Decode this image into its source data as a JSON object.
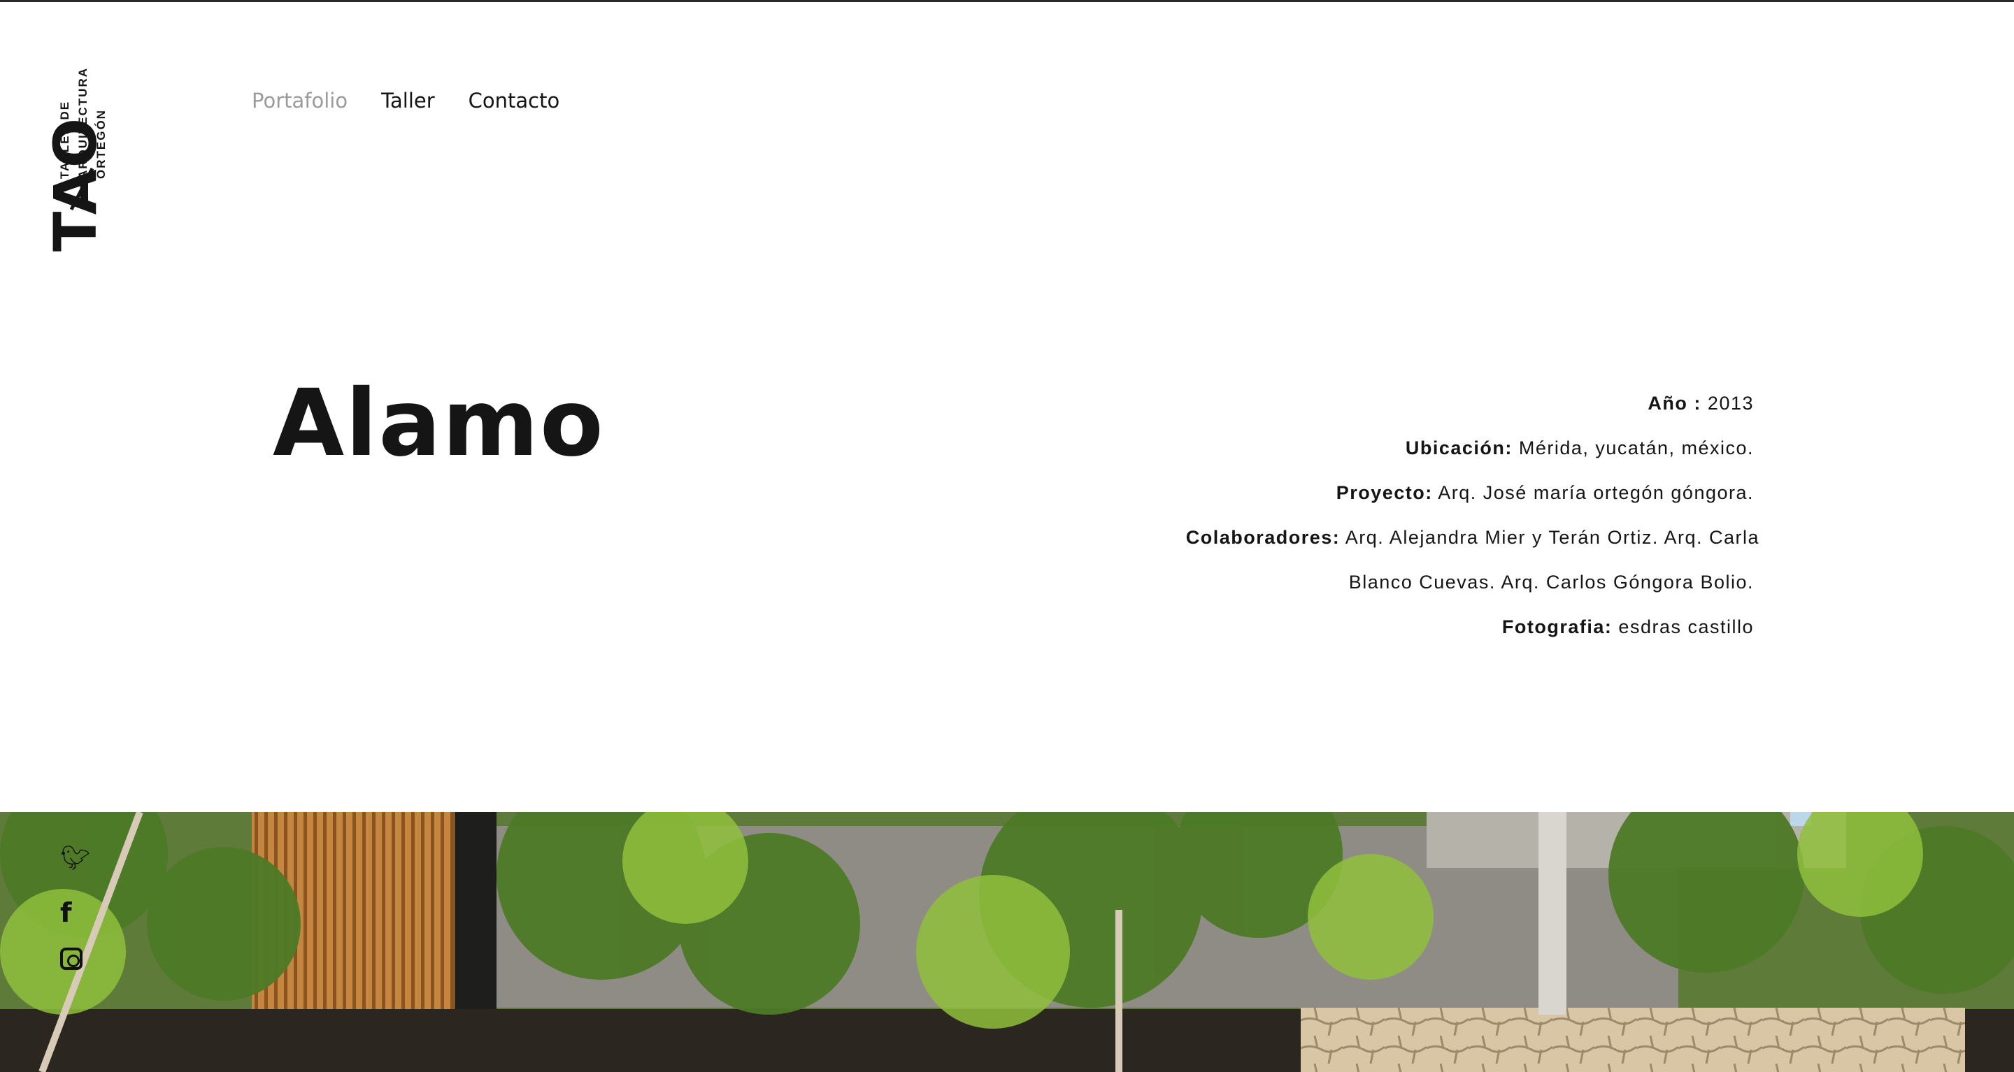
{
  "logo": {
    "mark": "TAO",
    "words": [
      "TALLER DE",
      "ARQUITECTURA",
      "ORTEGÓN"
    ]
  },
  "nav": {
    "items": [
      {
        "label": "Portafolio",
        "active": true
      },
      {
        "label": "Taller",
        "active": false
      },
      {
        "label": "Contacto",
        "active": false
      }
    ]
  },
  "project": {
    "title": "Alamo",
    "details": {
      "year_label": "Año :",
      "year_value": "2013",
      "location_label": "Ubicación:",
      "location_value": "Mérida, yucatán, méxico.",
      "project_label": "Proyecto:",
      "project_value": "Arq. José maría ortegón góngora.",
      "collab_label": "Colaboradores:",
      "collab_value_line1": "Arq. Alejandra Mier y Terán Ortiz. Arq. Carla",
      "collab_value_line2": "Blanco Cuevas. Arq. Carlos Góngora Bolio.",
      "photo_label": "Fotografia:",
      "photo_value": "esdras castillo"
    }
  },
  "hero": {
    "image": "house-garden-photo"
  },
  "social": [
    "twitter-icon",
    "facebook-icon",
    "instagram-icon"
  ]
}
